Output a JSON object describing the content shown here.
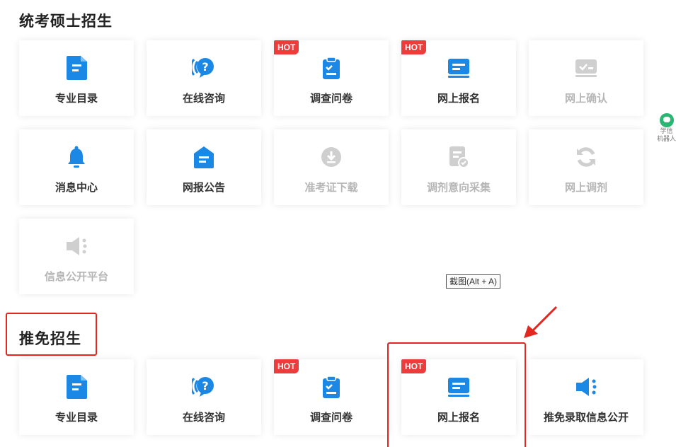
{
  "sections": [
    {
      "title": "统考硕士招生",
      "tiles": [
        {
          "label": "专业目录",
          "icon": "catalog-icon",
          "hot": false,
          "enabled": true
        },
        {
          "label": "在线咨询",
          "icon": "chat-question-icon",
          "hot": false,
          "enabled": true
        },
        {
          "label": "调查问卷",
          "icon": "clipboard-check-icon",
          "hot": true,
          "enabled": true
        },
        {
          "label": "网上报名",
          "icon": "online-form-icon",
          "hot": true,
          "enabled": true
        },
        {
          "label": "网上确认",
          "icon": "confirm-icon",
          "hot": false,
          "enabled": false
        },
        {
          "label": "消息中心",
          "icon": "bell-icon",
          "hot": false,
          "enabled": true
        },
        {
          "label": "网报公告",
          "icon": "notice-icon",
          "hot": false,
          "enabled": true
        },
        {
          "label": "准考证下载",
          "icon": "download-icon",
          "hot": false,
          "enabled": false
        },
        {
          "label": "调剂意向采集",
          "icon": "form-collect-icon",
          "hot": false,
          "enabled": false
        },
        {
          "label": "网上调剂",
          "icon": "refresh-icon",
          "hot": false,
          "enabled": false
        },
        {
          "label": "信息公开平台",
          "icon": "speaker-icon",
          "hot": false,
          "enabled": false
        }
      ]
    },
    {
      "title": "推免招生",
      "tiles": [
        {
          "label": "专业目录",
          "icon": "catalog-icon",
          "hot": false,
          "enabled": true
        },
        {
          "label": "在线咨询",
          "icon": "chat-question-icon",
          "hot": false,
          "enabled": true
        },
        {
          "label": "调查问卷",
          "icon": "clipboard-check-icon",
          "hot": true,
          "enabled": true
        },
        {
          "label": "网上报名",
          "icon": "online-form-icon",
          "hot": true,
          "enabled": true
        },
        {
          "label": "推免录取信息公开",
          "icon": "speaker-icon",
          "hot": false,
          "enabled": true
        }
      ]
    }
  ],
  "hot_label": "HOT",
  "tooltip": "截图(Alt + A)",
  "robot": {
    "line1": "学信",
    "line2": "机器人"
  },
  "colors": {
    "accent": "#1c88e6",
    "disabled": "#c9c9c9",
    "hot": "#ee3b3b",
    "highlight": "#e3261f"
  }
}
